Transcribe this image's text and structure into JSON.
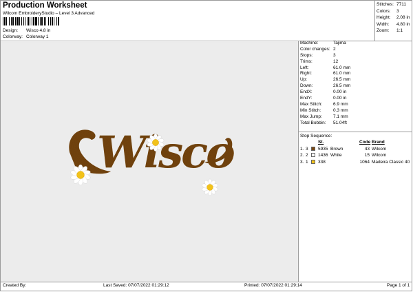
{
  "header": {
    "title": "Production Worksheet",
    "subtitle": "Wilcom EmbroideryStudio – Level 3 Advanced",
    "design_label": "Design:",
    "design_value": "Wisco 4.8 in",
    "colorway_label": "Colorway:",
    "colorway_value": "Colorway 1"
  },
  "stats": [
    {
      "label": "Stitches:",
      "value": "7711"
    },
    {
      "label": "Colors:",
      "value": "3"
    },
    {
      "label": "Height:",
      "value": "2.08 in"
    },
    {
      "label": "Width:",
      "value": "4.80 in"
    },
    {
      "label": "Zoom:",
      "value": "1:1"
    }
  ],
  "preview": {
    "text": "Wisco",
    "thread_color": "#7a4a16",
    "flower_petal": "#ffffff",
    "flower_center": "#f2c21a"
  },
  "machine_info": [
    {
      "label": "Machine:",
      "value": "Tajima"
    },
    {
      "label": "Color changes:",
      "value": "2"
    },
    {
      "label": "Stops:",
      "value": "3"
    },
    {
      "label": "Trims:",
      "value": "12"
    },
    {
      "label": "Left:",
      "value": "61.0 mm"
    },
    {
      "label": "Right:",
      "value": "61.0 mm"
    },
    {
      "label": "Up:",
      "value": "26.5 mm"
    },
    {
      "label": "Down:",
      "value": "26.5 mm"
    },
    {
      "label": "EndX:",
      "value": "0.00 in"
    },
    {
      "label": "EndY:",
      "value": "0.00 in"
    },
    {
      "label": "Max Stitch:",
      "value": "6.9 mm"
    },
    {
      "label": "Min Stitch:",
      "value": "0.3 mm"
    },
    {
      "label": "Max Jump:",
      "value": "7.1 mm"
    },
    {
      "label": "Total Bobbin:",
      "value": "51.04ft"
    }
  ],
  "stop_sequence": {
    "title": "Stop Sequence:",
    "headers": {
      "st": "St.",
      "code": "Code",
      "brand": "Brand"
    },
    "rows": [
      {
        "num": "1.",
        "stop": "3",
        "color": "#7a4a16",
        "st": "5935",
        "name": "Brown",
        "code": "43",
        "brand": "Wilcom"
      },
      {
        "num": "2.",
        "stop": "2",
        "color": "#ffffff",
        "st": "1436",
        "name": "White",
        "code": "15",
        "brand": "Wilcom"
      },
      {
        "num": "3.",
        "stop": "1",
        "color": "#f2c21a",
        "st": "338",
        "name": "",
        "code": "1064",
        "brand": "Madeira Classic 40"
      }
    ]
  },
  "footer": {
    "created_by": "Created By:",
    "last_saved": "Last Saved: 07/07/2022 01:29:12",
    "printed": "Printed: 07/07/2022 01:29:14",
    "page": "Page 1 of 1"
  }
}
